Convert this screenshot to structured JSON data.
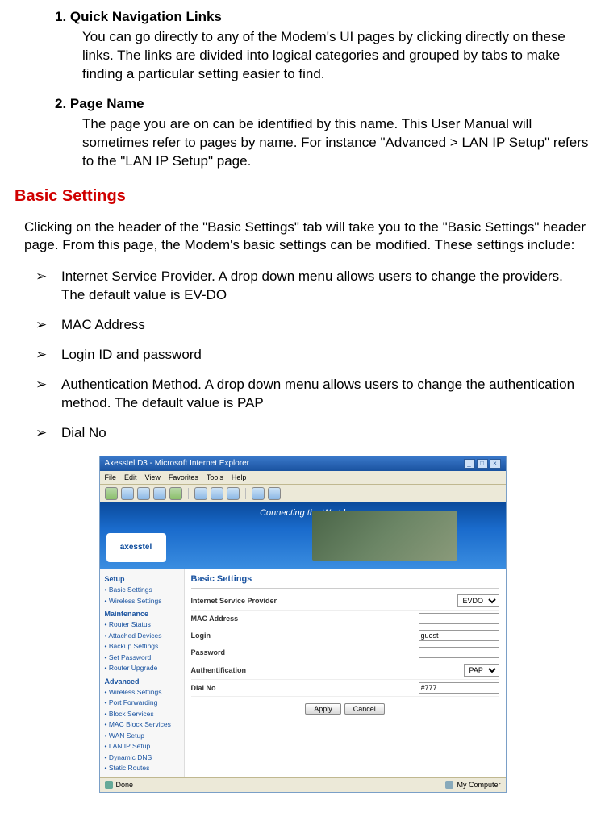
{
  "numbered": [
    {
      "title": "1. Quick Navigation Links",
      "body": "You can go directly to any of the Modem's UI pages by clicking directly on these links. The links are divided into logical categories and grouped by tabs to make finding a particular setting easier to find."
    },
    {
      "title": "2. Page Name",
      "body": "The page you are on can be identified by this name. This User Manual will sometimes refer to pages by name. For instance \"Advanced > LAN IP Setup\" refers to the \"LAN IP Setup\" page."
    }
  ],
  "section_heading": "Basic Settings",
  "intro_para": "Clicking on the header of the \"Basic Settings\" tab will take you to the \"Basic Settings\" header page. From this page, the Modem's basic settings can be modified. These settings include:",
  "bullets": [
    "Internet Service Provider. A drop down menu allows users to change the providers. The default value is EV-DO",
    "MAC Address",
    "Login ID and password",
    "Authentication Method. A drop down menu allows users to change the authentication method. The default value is PAP",
    "Dial No"
  ],
  "browser": {
    "title": "Axesstel D3 - Microsoft Internet Explorer",
    "menus": [
      "File",
      "Edit",
      "View",
      "Favorites",
      "Tools",
      "Help"
    ],
    "banner_tagline": "Connecting the World",
    "logo_text": "axesstel",
    "sidebar": {
      "groups": [
        {
          "head": "Setup",
          "items": [
            "Basic Settings",
            "Wireless Settings"
          ]
        },
        {
          "head": "Maintenance",
          "items": [
            "Router Status",
            "Attached Devices",
            "Backup Settings",
            "Set Password",
            "Router Upgrade"
          ]
        },
        {
          "head": "Advanced",
          "items": [
            "Wireless Settings",
            "Port Forwarding",
            "Block Services",
            "MAC Block Services",
            "WAN Setup",
            "LAN IP Setup",
            "Dynamic DNS",
            "Static Routes"
          ]
        }
      ]
    },
    "content": {
      "title": "Basic Settings",
      "rows": [
        {
          "label": "Internet Service Provider",
          "type": "select",
          "value": "EVDO"
        },
        {
          "label": "MAC Address",
          "type": "text",
          "value": ""
        },
        {
          "label": "Login",
          "type": "text",
          "value": "guest"
        },
        {
          "label": "Password",
          "type": "text",
          "value": ""
        },
        {
          "label": "Authentification",
          "type": "select",
          "value": "PAP"
        },
        {
          "label": "Dial No",
          "type": "text",
          "value": "#777"
        }
      ],
      "buttons": [
        "Apply",
        "Cancel"
      ]
    },
    "status_left": "Done",
    "status_right": "My Computer"
  }
}
